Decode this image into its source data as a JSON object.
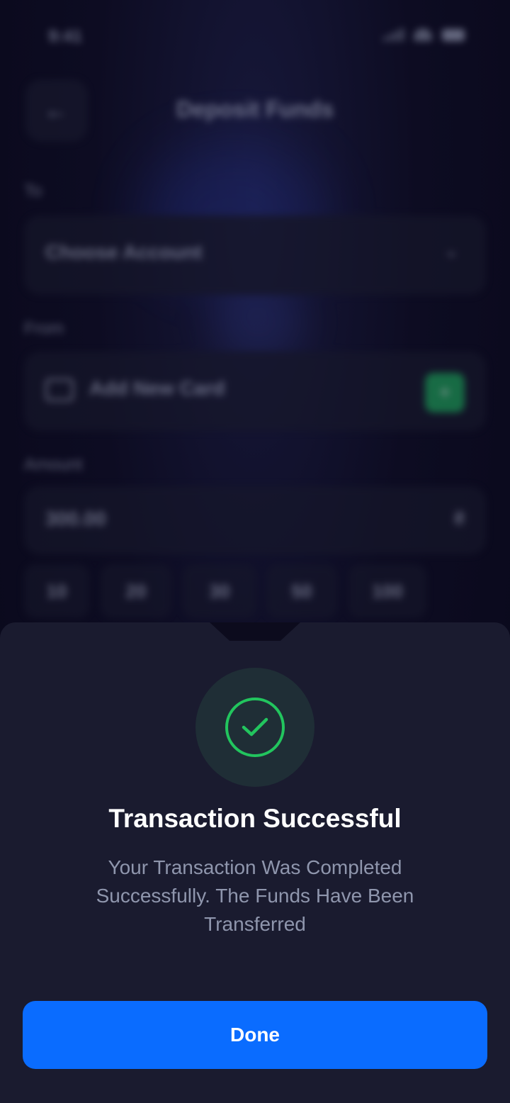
{
  "status_bar": {
    "time": "9:41"
  },
  "header": {
    "title": "Deposit Funds",
    "back_icon": "arrow-left-icon"
  },
  "form": {
    "to": {
      "label": "To",
      "value": "Choose Account"
    },
    "from": {
      "label": "From",
      "value": "Add New Card",
      "add_symbol": "+"
    },
    "amount": {
      "label": "Amount",
      "value": "300.00",
      "suffix": "₴"
    },
    "quick_amounts": [
      "10",
      "20",
      "30",
      "50",
      "100"
    ]
  },
  "dialog": {
    "icon": "check-circle-icon",
    "title": "Transaction Successful",
    "message": "Your Transaction Was Completed Successfully. The Funds Have Been Transferred",
    "done_label": "Done"
  },
  "colors": {
    "accent": "#0a6cff",
    "success": "#22c55e",
    "sheet_background": "#1a1b2f"
  }
}
